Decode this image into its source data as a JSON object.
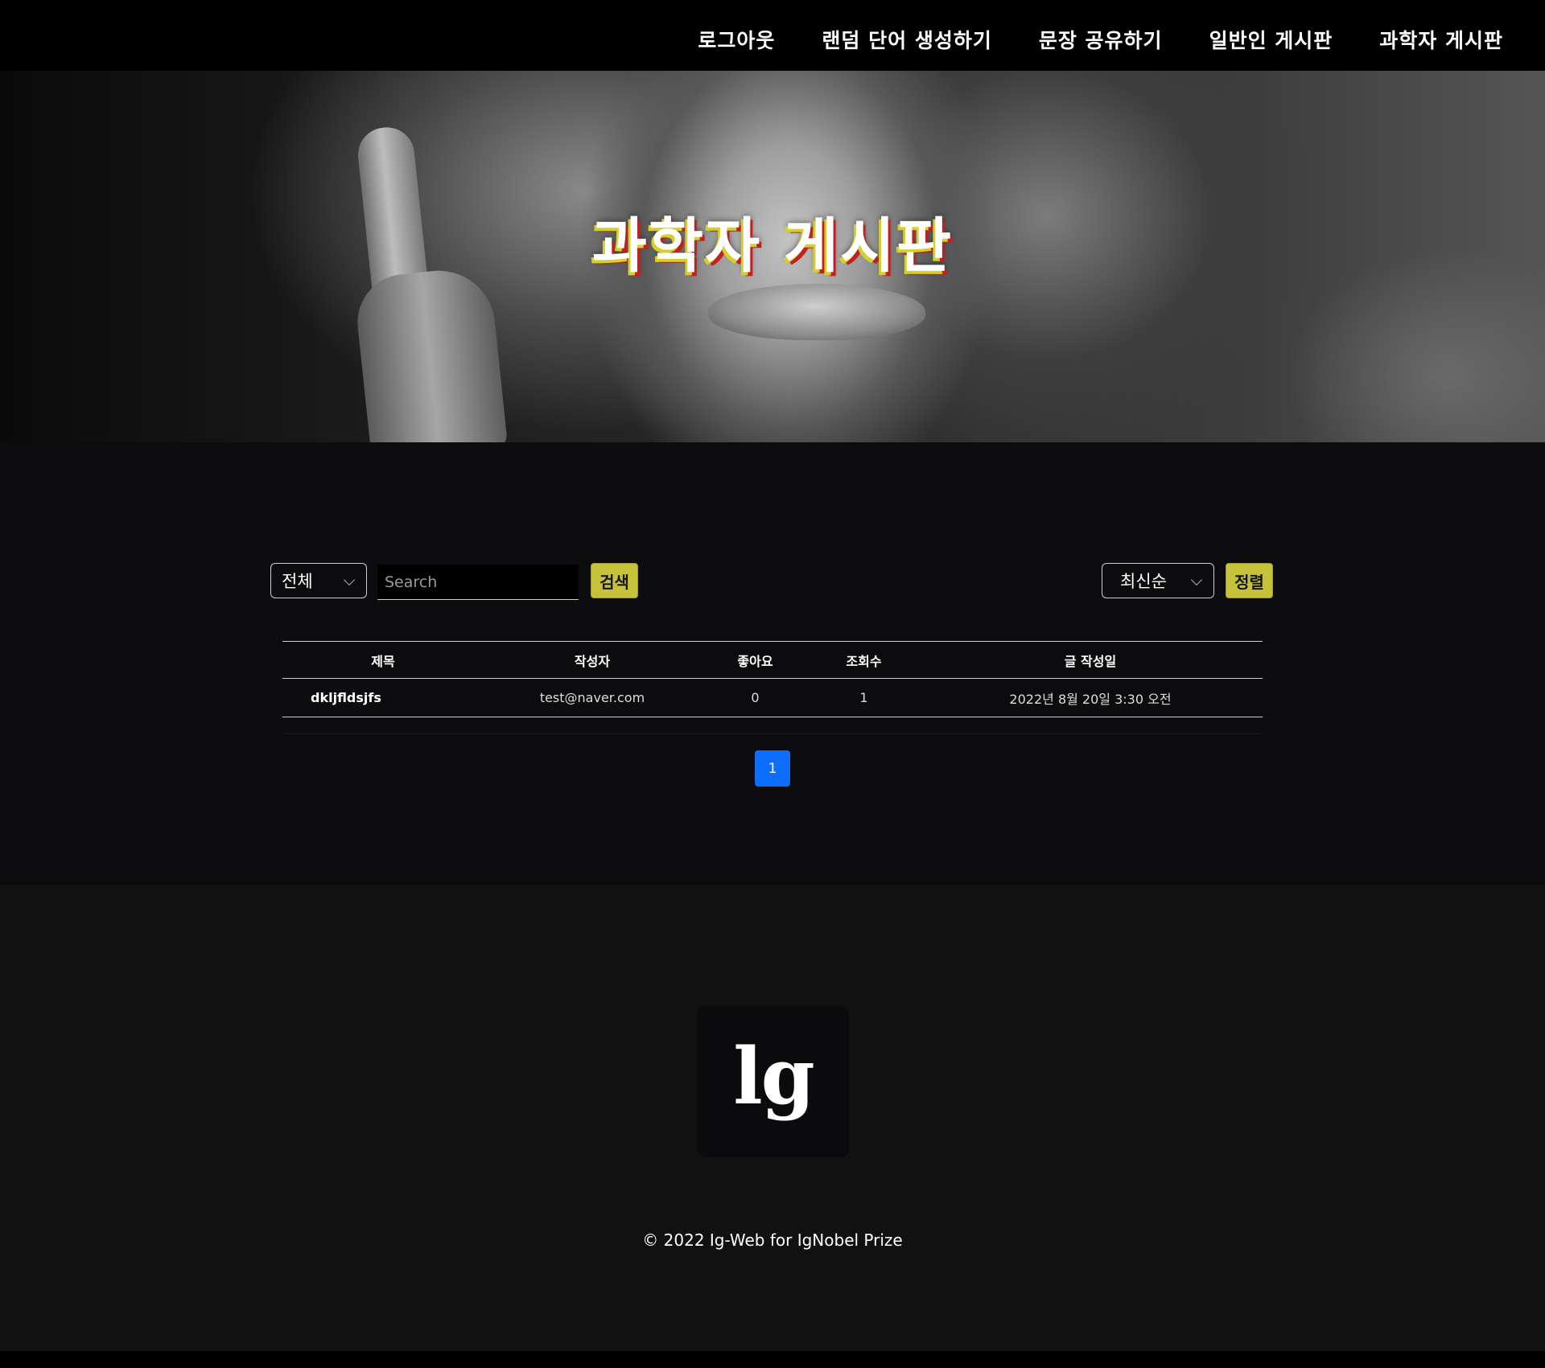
{
  "nav": {
    "items": [
      {
        "label": "로그아웃"
      },
      {
        "label": "랜덤 단어 생성하기"
      },
      {
        "label": "문장 공유하기"
      },
      {
        "label": "일반인 게시판"
      },
      {
        "label": "과학자 게시판"
      }
    ]
  },
  "hero": {
    "title": "과학자 게시판"
  },
  "filters": {
    "category_selected": "전체",
    "search_placeholder": "Search",
    "search_button": "검색",
    "sort_selected": "최신순",
    "sort_button": "정렬"
  },
  "table": {
    "columns": [
      "제목",
      "작성자",
      "좋아요",
      "조회수",
      "글 작성일"
    ],
    "rows": [
      {
        "title": "dkljfldsjfs",
        "author": "test@naver.com",
        "likes": "0",
        "views": "1",
        "date": "2022년 8월 20일 3:30 오전"
      }
    ]
  },
  "pagination": {
    "pages": [
      "1"
    ],
    "current": "1"
  },
  "footer": {
    "logo": "lg",
    "copyright": "© 2022 Ig-Web for IgNobel Prize"
  },
  "colors": {
    "accent_yellow": "#c6c33a",
    "pagination_blue": "#0d6efd",
    "background": "#0c0b0d",
    "nav_background": "#000000"
  }
}
